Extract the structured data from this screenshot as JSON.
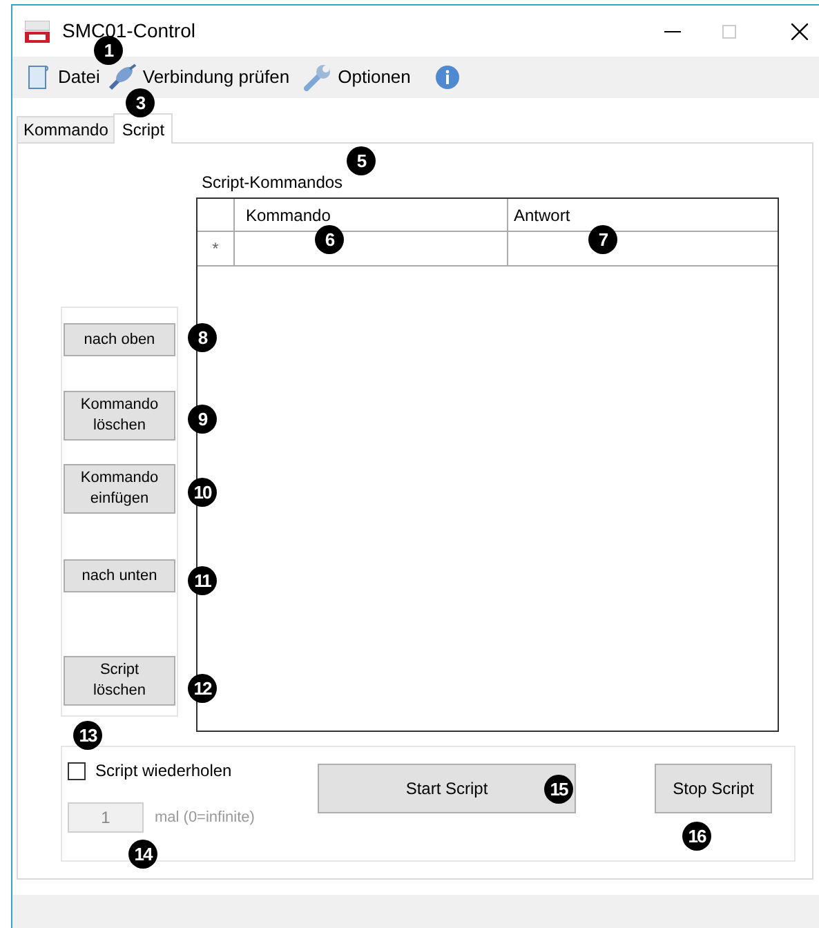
{
  "window": {
    "title": "SMC01-Control"
  },
  "toolbar": [
    {
      "kind": "file",
      "label": "Datei"
    },
    {
      "kind": "plug",
      "label": "Verbindung prüfen"
    },
    {
      "kind": "wrench",
      "label": "Optionen"
    },
    {
      "kind": "info"
    }
  ],
  "tabs": [
    {
      "label": "Kommando",
      "selected": false
    },
    {
      "label": "Script",
      "selected": true
    }
  ],
  "grid": {
    "label": "Script-Kommandos",
    "columns": [
      "Kommando",
      "Antwort"
    ],
    "new_row_marker": "*"
  },
  "side_buttons": [
    {
      "label": "nach oben"
    },
    {
      "label": "Kommando löschen"
    },
    {
      "label": "Kommando einfügen"
    },
    {
      "label": "nach unten"
    },
    {
      "label": "Script löschen"
    }
  ],
  "repeat": {
    "label": "Script wiederholen",
    "checked": false,
    "count": "1",
    "count_disabled": true,
    "suffix": "mal (0=infinite)"
  },
  "actions": [
    {
      "label": "Start Script"
    },
    {
      "label": "Stop Script"
    }
  ],
  "callouts": [
    "1",
    "3",
    "5",
    "6",
    "7",
    "8",
    "9",
    "10",
    "11",
    "12",
    "13",
    "14",
    "15",
    "16"
  ]
}
